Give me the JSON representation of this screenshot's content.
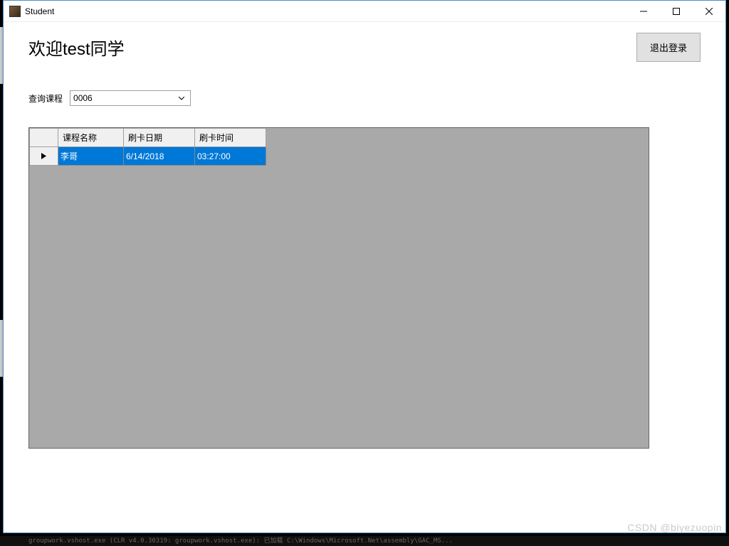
{
  "window": {
    "title": "Student"
  },
  "header": {
    "welcome": "欢迎test同学",
    "logout_button": "退出登录"
  },
  "query": {
    "label": "查询课程",
    "selected_course": "0006"
  },
  "grid": {
    "columns": {
      "course_name": "课程名称",
      "swipe_date": "刷卡日期",
      "swipe_time": "刷卡时间"
    },
    "rows": [
      {
        "course_name": "李哥",
        "swipe_date": "6/14/2018",
        "swipe_time": "03:27:00"
      }
    ]
  },
  "watermark": "CSDN @biyezuopin",
  "console_hint": "groupwork.vshost.exe  (CLR v4.0.30319: groupwork.vshost.exe):  已加载  C:\\Windows\\Microsoft.Net\\assembly\\GAC_MS..."
}
